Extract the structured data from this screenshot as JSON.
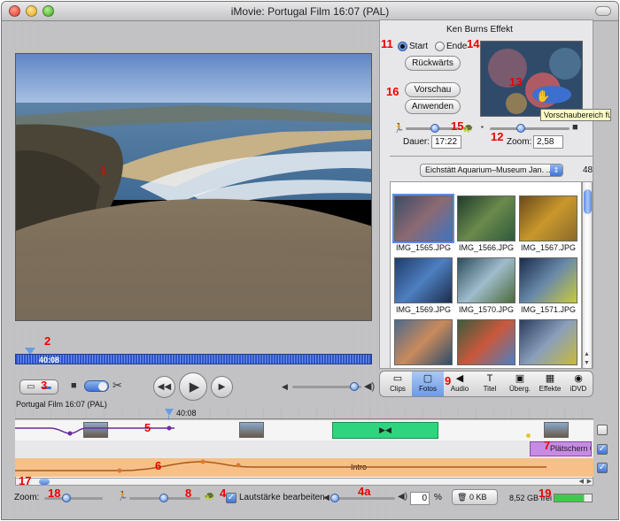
{
  "window": {
    "title": "iMovie: Portugal Film  16:07 (PAL)"
  },
  "colors": {
    "accent": "#4e82df",
    "timeline_clip_green": "#2fd47e",
    "audio_clip_purple": "#c78be3",
    "audio_track_orange": "#f6c088",
    "annotation_red": "#e00000"
  },
  "monitor": {
    "scrubber_time": "40:08"
  },
  "ken_burns": {
    "title": "Ken Burns Effekt",
    "start_label": "Start",
    "end_label": "Ende",
    "reverse_button": "Rückwärts",
    "preview_button": "Vorschau",
    "apply_button": "Anwenden",
    "duration_label": "Dauer:",
    "duration_value": "17:22",
    "zoom_label": "Zoom:",
    "zoom_value": "2,58",
    "tooltip": "Vorschaubereich fü"
  },
  "photo_browser": {
    "album": "Eichstätt Aquarium–Museum Jan. ...",
    "count": "48",
    "thumbnails": [
      {
        "label": "IMG_1565.JPG"
      },
      {
        "label": "IMG_1566.JPG"
      },
      {
        "label": "IMG_1567.JPG"
      },
      {
        "label": "IMG_1569.JPG"
      },
      {
        "label": "IMG_1570.JPG"
      },
      {
        "label": "IMG_1571.JPG"
      },
      {
        "label": ""
      },
      {
        "label": ""
      },
      {
        "label": ""
      }
    ]
  },
  "modes": [
    {
      "label": "Clips",
      "icon": "clips-icon",
      "glyph": "▭"
    },
    {
      "label": "Fotos",
      "icon": "photos-icon",
      "glyph": "▢"
    },
    {
      "label": "Audio",
      "icon": "audio-icon",
      "glyph": "◀"
    },
    {
      "label": "Titel",
      "icon": "title-icon",
      "glyph": "T"
    },
    {
      "label": "Überg.",
      "icon": "transitions-icon",
      "glyph": "▣"
    },
    {
      "label": "Effekte",
      "icon": "effects-icon",
      "glyph": "▦"
    },
    {
      "label": "iDVD",
      "icon": "idvd-icon",
      "glyph": "◉"
    }
  ],
  "timeline": {
    "project_label": "Portugal Film  16:07 (PAL)",
    "playhead_time": "40:08",
    "audio_clip_label": "Plätschern 02",
    "audio_track_label": "Intro"
  },
  "bottom_bar": {
    "zoom_label": "Zoom:",
    "volume_checkbox_label": "Lautstärke bearbeiten",
    "volume_value": "0",
    "volume_unit": "%",
    "trash_label": "0 KB",
    "disk_free": "8,52 GB frei"
  },
  "annotations": [
    "1",
    "2",
    "3",
    "4",
    "4a",
    "5",
    "6",
    "7",
    "8",
    "9",
    "11",
    "12",
    "13",
    "14",
    "15",
    "16",
    "17",
    "18",
    "19"
  ]
}
